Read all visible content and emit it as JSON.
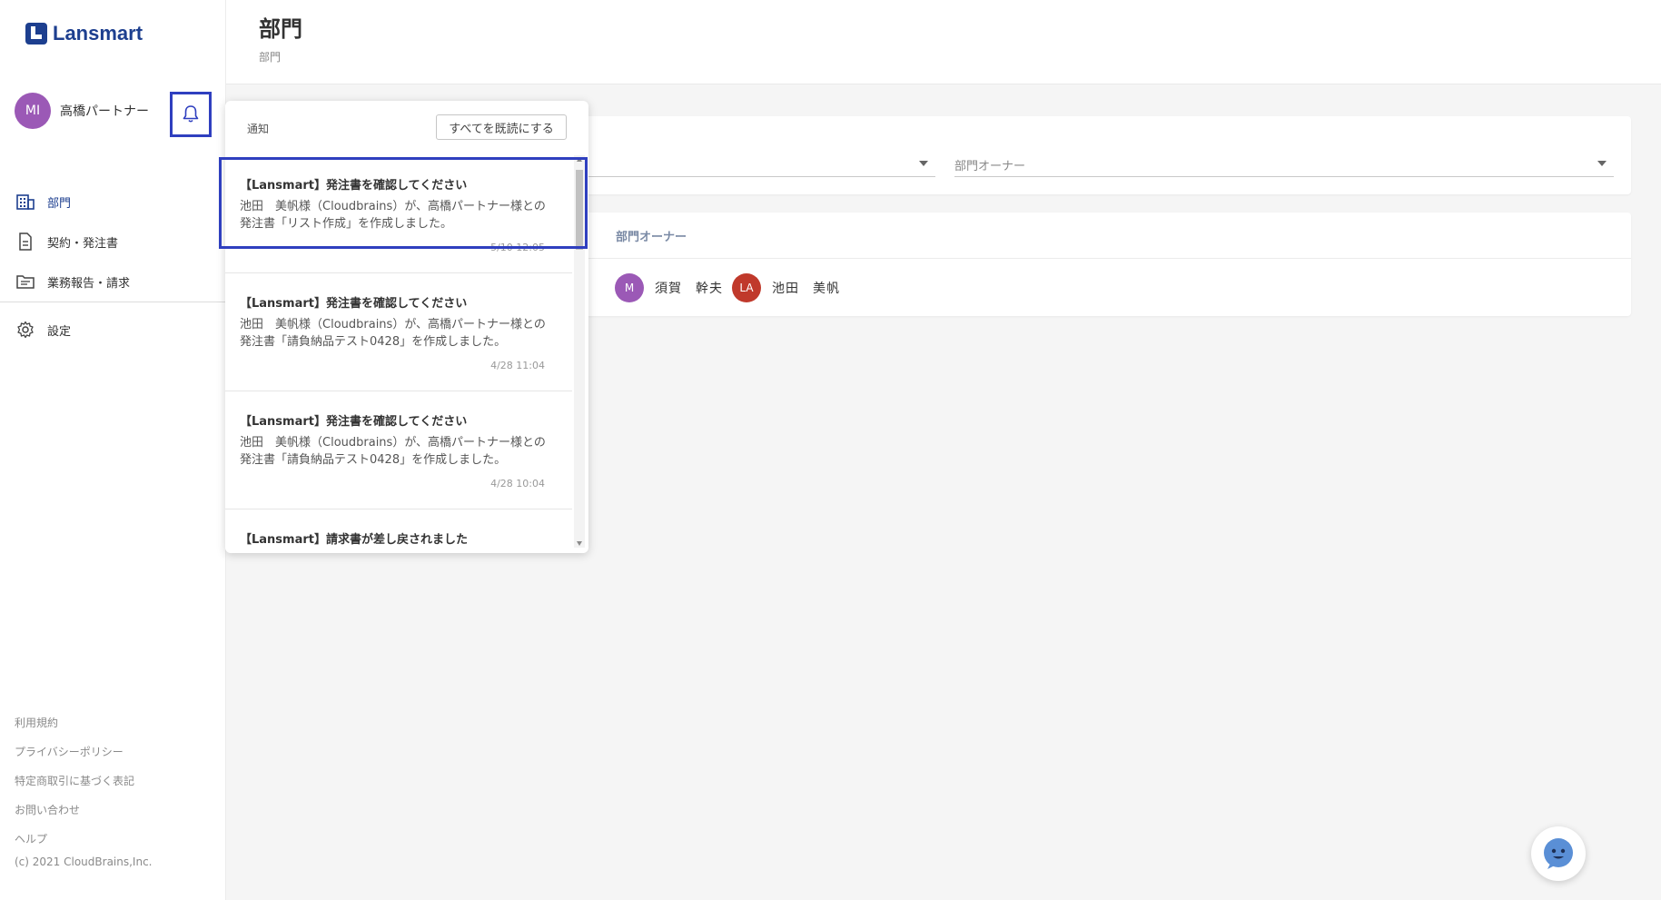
{
  "brand": {
    "name": "Lansmart"
  },
  "user": {
    "initials": "MI",
    "name": "高橋パートナー",
    "avatar_color": "#9b59b6"
  },
  "nav": {
    "items": [
      {
        "label": "部門",
        "icon": "building-icon",
        "active": true
      },
      {
        "label": "契約・発注書",
        "icon": "document-icon",
        "active": false
      },
      {
        "label": "業務報告・請求",
        "icon": "folder-icon",
        "active": false
      }
    ],
    "settings": {
      "label": "設定",
      "icon": "gear-icon"
    }
  },
  "footer": {
    "links": [
      "利用規約",
      "プライバシーポリシー",
      "特定商取引に基づく表記",
      "お問い合わせ",
      "ヘルプ"
    ],
    "copyright": "(c) 2021 CloudBrains,Inc."
  },
  "header": {
    "title": "部門",
    "breadcrumb": "部門"
  },
  "filters": {
    "owner_label": "部門オーナー"
  },
  "table": {
    "owner_header": "部門オーナー",
    "members": [
      {
        "initials": "M",
        "name": "須賀　幹夫",
        "color": "#9b59b6"
      },
      {
        "initials": "LA",
        "name": "池田　美帆",
        "color": "#c0392b"
      }
    ]
  },
  "notifications": {
    "title": "通知",
    "mark_all_read": "すべてを既読にする",
    "items": [
      {
        "title": "【Lansmart】発注書を確認してください",
        "line1": "池田　美帆様（Cloudbrains）が、高橋パートナー様との",
        "line2": "発注書「リスト作成」を作成しました。",
        "time": "5/10 12:05"
      },
      {
        "title": "【Lansmart】発注書を確認してください",
        "line1": "池田　美帆様（Cloudbrains）が、高橋パートナー様との",
        "line2": "発注書「請負納品テスト0428」を作成しました。",
        "time": "4/28 11:04"
      },
      {
        "title": "【Lansmart】発注書を確認してください",
        "line1": "池田　美帆様（Cloudbrains）が、高橋パートナー様との",
        "line2": "発注書「請負納品テスト0428」を作成しました。",
        "time": "4/28 10:04"
      },
      {
        "title": "【Lansmart】請求書が差し戻されました",
        "line1": "",
        "line2": "",
        "time": ""
      }
    ]
  },
  "colors": {
    "brand": "#1d3f8f",
    "highlight": "#2f3fbf"
  }
}
